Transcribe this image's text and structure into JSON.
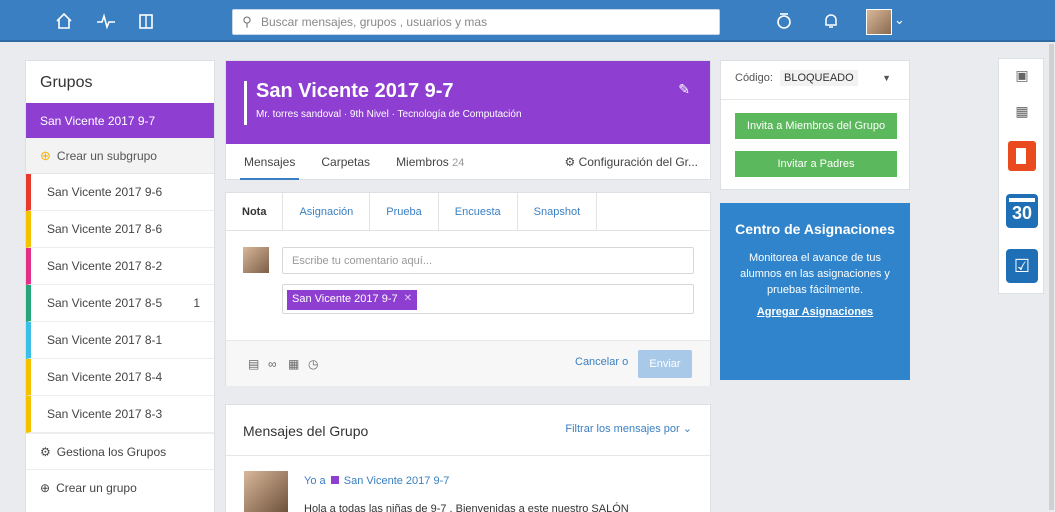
{
  "topbar": {
    "search_placeholder": "Buscar mensajes, grupos , usuarios y mas",
    "icons": [
      "home-icon",
      "activity-icon",
      "backpack-icon",
      "connections-icon",
      "bell-icon"
    ]
  },
  "sidebar": {
    "title": "Grupos",
    "active": "San Vicente 2017 9-7",
    "create_subgroup": "Crear un subgrupo",
    "groups": [
      {
        "name": "San Vicente 2017 9-6",
        "color": "#e8392d",
        "count": ""
      },
      {
        "name": "San Vicente 2017 8-6",
        "color": "#f5c200",
        "count": ""
      },
      {
        "name": "San Vicente 2017 8-2",
        "color": "#e22f8a",
        "count": ""
      },
      {
        "name": "San Vicente 2017 8-5",
        "color": "#26a578",
        "count": "1"
      },
      {
        "name": "San Vicente 2017 8-1",
        "color": "#3cbfe6",
        "count": ""
      },
      {
        "name": "San Vicente 2017 8-4",
        "color": "#f5c200",
        "count": ""
      },
      {
        "name": "San Vicente 2017 8-3",
        "color": "#f5c200",
        "count": ""
      }
    ],
    "manage": "Gestiona los Grupos",
    "create_group": "Crear un grupo"
  },
  "group": {
    "title": "San Vicente 2017 9-7",
    "subtitle": "Mr. torres sandoval · 9th Nivel · Tecnología de Computación",
    "tabs": {
      "messages": "Mensajes",
      "folders": "Carpetas",
      "members": "Miembros",
      "members_count": "24"
    },
    "config": "Configuración del Gr..."
  },
  "composer": {
    "tabs": [
      "Nota",
      "Asignación",
      "Prueba",
      "Encuesta",
      "Snapshot"
    ],
    "placeholder": "Escribe tu comentario aquí...",
    "recipient": "San Vicente 2017 9-7",
    "cancel": "Cancelar o",
    "send": "Enviar"
  },
  "messages": {
    "title": "Mensajes del Grupo",
    "filter": "Filtrar los mensajes por",
    "post_author": "Yo a",
    "post_group": "San Vicente 2017 9-7",
    "post_body": "Hola a todas las niñas de 9-7 . Bienvenidas a este nuestro  SALÓN"
  },
  "code_panel": {
    "label": "Código:",
    "value": "BLOQUEADO",
    "invite_members": "Invita a Miembros del Grupo",
    "invite_parents": "Invitar a Padres"
  },
  "promo": {
    "title": "Centro de Asignaciones",
    "desc": "Monitorea el avance de tus alumnos en las asignaciones y pruebas fácilmente.",
    "link": "Agregar Asignaciones"
  },
  "apps": {
    "calendar_day": "30",
    "icons": [
      "store-icon",
      "apps-grid-icon",
      "office-icon",
      "calendar-icon",
      "quiz-icon"
    ]
  },
  "colors": {
    "brand": "#3a7fc1",
    "group": "#8e3fd1",
    "action": "#5cb85c"
  }
}
